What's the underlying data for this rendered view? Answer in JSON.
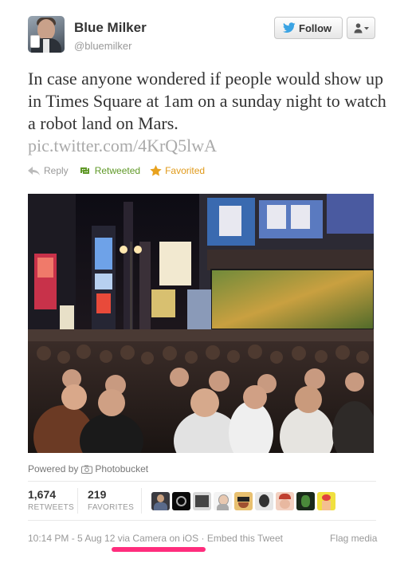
{
  "user": {
    "name": "Blue Milker",
    "handle": "@bluemilker"
  },
  "header": {
    "follow_label": "Follow",
    "follow_icon": "twitter-bird-icon",
    "user_menu_icon": "user-dropdown-icon"
  },
  "tweet": {
    "text": "In case anyone wondered if people would show up in Times Square at 1am on a sunday night to watch a robot land on Mars.",
    "link": "pic.twitter.com/4KrQ5lwA"
  },
  "actions": {
    "reply": "Reply",
    "retweeted": "Retweeted",
    "favorited": "Favorited"
  },
  "media": {
    "powered_by": "Powered by",
    "provider": "Photobucket"
  },
  "stats": {
    "retweets_count": "1,674",
    "retweets_label": "RETWEETS",
    "favorites_count": "219",
    "favorites_label": "FAVORITES"
  },
  "footer": {
    "timestamp": "10:14 PM - 5 Aug 12",
    "via": "via Camera on iOS",
    "separator": "·",
    "embed": "Embed this Tweet",
    "flag": "Flag media"
  },
  "colors": {
    "retweet_green": "#609928",
    "favorite_orange": "#e09a1a",
    "link_gray": "#aaaaaa",
    "highlight_pink": "#ff2d7d",
    "twitter_blue": "#3aa3e3"
  }
}
